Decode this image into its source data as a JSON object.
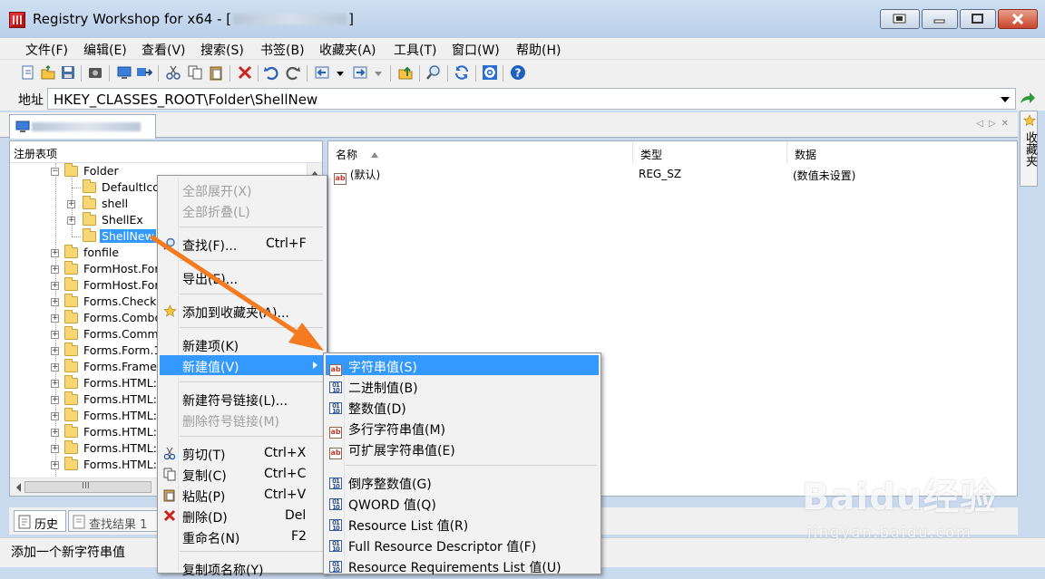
{
  "window": {
    "title_prefix": "Registry Workshop for x64 - [",
    "title_suffix": "]"
  },
  "menu": [
    "文件(F)",
    "编辑(E)",
    "查看(V)",
    "搜索(S)",
    "书签(B)",
    "收藏夹(A)",
    "工具(T)",
    "窗口(W)",
    "帮助(H)"
  ],
  "address": {
    "label": "地址",
    "value": "HKEY_CLASSES_ROOT\\Folder\\ShellNew"
  },
  "sidebar": {
    "label": "收藏夹"
  },
  "tree": {
    "header": "注册表项",
    "items": [
      {
        "label": "Folder",
        "expanded": true
      },
      {
        "label": "DefaultIcon"
      },
      {
        "label": "shell"
      },
      {
        "label": "ShellEx"
      },
      {
        "label": "ShellNew",
        "selected": true
      },
      {
        "label": "fonfile"
      },
      {
        "label": "FormHost.Form"
      },
      {
        "label": "FormHost.Form"
      },
      {
        "label": "Forms.CheckB"
      },
      {
        "label": "Forms.Combo"
      },
      {
        "label": "Forms.Comma"
      },
      {
        "label": "Forms.Form.1"
      },
      {
        "label": "Forms.Frame.1"
      },
      {
        "label": "Forms.HTML:C"
      },
      {
        "label": "Forms.HTML:H"
      },
      {
        "label": "Forms.HTML:I"
      },
      {
        "label": "Forms.HTML:C"
      },
      {
        "label": "Forms.HTML:P"
      },
      {
        "label": "Forms.HTML:R"
      }
    ],
    "hscroll_thumb": "III"
  },
  "list": {
    "columns": [
      "名称",
      "类型",
      "数据"
    ],
    "rows": [
      {
        "name": "(默认)",
        "type": "REG_SZ",
        "data": "(数值未设置)"
      }
    ]
  },
  "bottom_tabs": [
    "历史",
    "查找结果 1"
  ],
  "status": "添加一个新字符串值",
  "context_menu": {
    "items": [
      {
        "label": "全部展开(X)",
        "disabled": true
      },
      {
        "label": "全部折叠(L)",
        "disabled": true
      },
      {
        "label": "查找(F)...",
        "shortcut": "Ctrl+F",
        "icon": "search-icon"
      },
      {
        "label": "导出(E)..."
      },
      {
        "label": "添加到收藏夹(A)...",
        "icon": "star-icon"
      },
      {
        "label": "新建项(K)"
      },
      {
        "label": "新建值(V)",
        "highlighted": true,
        "submenu": true
      },
      {
        "label": "新建符号链接(L)..."
      },
      {
        "label": "删除符号链接(M)",
        "disabled": true
      },
      {
        "label": "剪切(T)",
        "shortcut": "Ctrl+X",
        "icon": "scissors-icon"
      },
      {
        "label": "复制(C)",
        "shortcut": "Ctrl+C",
        "icon": "copy-icon"
      },
      {
        "label": "粘贴(P)",
        "shortcut": "Ctrl+V",
        "icon": "paste-icon"
      },
      {
        "label": "删除(D)",
        "shortcut": "Del",
        "icon": "delete-icon"
      },
      {
        "label": "重命名(N)",
        "shortcut": "F2"
      },
      {
        "label": "复制项名称(Y)"
      }
    ]
  },
  "submenu": {
    "items": [
      {
        "label": "字符串值(S)",
        "icon": "string-value-icon",
        "highlighted": true
      },
      {
        "label": "二进制值(B)",
        "icon": "binary-value-icon"
      },
      {
        "label": "整数值(D)",
        "icon": "binary-value-icon"
      },
      {
        "label": "多行字符串值(M)",
        "icon": "string-value-icon"
      },
      {
        "label": "可扩展字符串值(E)",
        "icon": "string-value-icon"
      },
      {
        "label": "倒序整数值(G)",
        "icon": "binary-value-icon"
      },
      {
        "label": "QWORD 值(Q)",
        "icon": "binary-value-icon"
      },
      {
        "label": "Resource List 值(R)",
        "icon": "binary-value-icon"
      },
      {
        "label": "Full Resource Descriptor 值(F)",
        "icon": "binary-value-icon"
      },
      {
        "label": "Resource Requirements List 值(U)",
        "icon": "binary-value-icon"
      }
    ]
  },
  "watermark": {
    "logo": "Baidu经验",
    "url": "jingyan.baidu.com"
  },
  "colors": {
    "highlight": "#3399ff",
    "arrow": "#f47b20",
    "titlebar": "#c4d6ee"
  }
}
